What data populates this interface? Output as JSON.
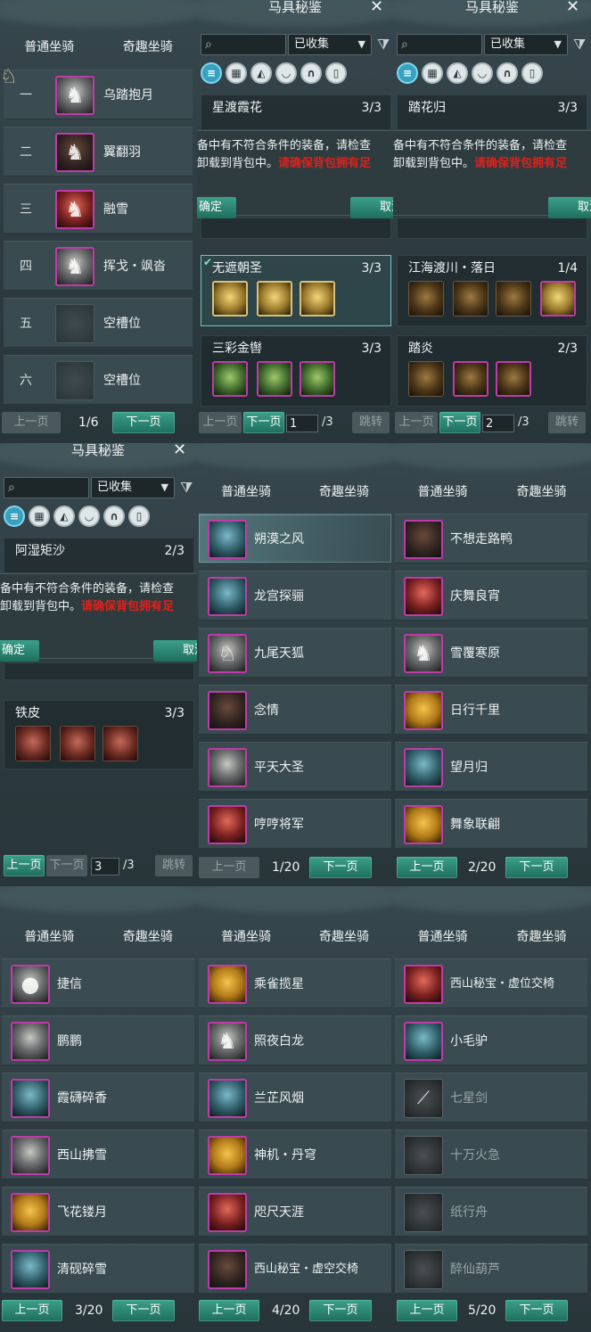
{
  "tabs": {
    "normal": "普通坐骑",
    "fun": "奇趣坐骑"
  },
  "pager": {
    "prev": "上一页",
    "next": "下一页",
    "jump": "跳转"
  },
  "dialog": {
    "line1": "备中有不符合条件的装备，请检查",
    "line2a": "卸载到背包中。",
    "line2b": "请确保背包拥有足",
    "ok": "确定",
    "cancel": "取消"
  },
  "codex": {
    "title": "马具秘鉴",
    "filter_value": "已收集"
  },
  "p1": {
    "page": "1/6",
    "rows": [
      {
        "num": "一",
        "name": "乌踏抱月"
      },
      {
        "num": "二",
        "name": "翼翻羽"
      },
      {
        "num": "三",
        "name": "融雪"
      },
      {
        "num": "四",
        "name": "挥戈・飒沓"
      },
      {
        "num": "五",
        "name": "空槽位"
      },
      {
        "num": "六",
        "name": "空槽位"
      }
    ]
  },
  "p2": {
    "page_input": "1",
    "total": "/3",
    "sets": [
      {
        "name": "星渡霞花",
        "count": "3/3"
      },
      {
        "name": "无遮朝圣",
        "count": "3/3"
      },
      {
        "name": "三彩金辔",
        "count": "3/3"
      }
    ]
  },
  "p3": {
    "page_input": "2",
    "total": "/3",
    "sets": [
      {
        "name": "踏花归",
        "count": "3/3"
      },
      {
        "name": "江海渡川・落日",
        "count": "1/4"
      },
      {
        "name": "踏炎",
        "count": "2/3"
      }
    ]
  },
  "p4": {
    "page_input": "3",
    "total": "/3",
    "sets": [
      {
        "name": "阿湿矩沙",
        "count": "2/3"
      },
      {
        "name": "铁皮",
        "count": "3/3"
      }
    ]
  },
  "p5": {
    "page": "1/20",
    "rows": [
      "朔漠之风",
      "龙宫探骊",
      "九尾天狐",
      "念情",
      "平天大圣",
      "哼哼将军"
    ]
  },
  "p6": {
    "page": "2/20",
    "rows": [
      "不想走路鸭",
      "庆舞良宵",
      "雪覆寒原",
      "日行千里",
      "望月归",
      "舞象联翩"
    ]
  },
  "p7": {
    "page": "3/20",
    "rows": [
      "捷信",
      "鹏鹏",
      "霞礴碎香",
      "西山拂雪",
      "飞花镂月",
      "清砚碎雪"
    ]
  },
  "p8": {
    "page": "4/20",
    "rows": [
      "乘雀揽星",
      "照夜白龙",
      "兰芷风烟",
      "神机・丹穹",
      "咫尺天涯",
      "西山秘宝・虚空交椅"
    ]
  },
  "p9": {
    "page": "5/20",
    "rows": [
      "西山秘宝・虚位交椅",
      "小毛驴",
      "七星剑",
      "十万火急",
      "纸行舟",
      "醉仙葫芦"
    ]
  },
  "colors": {
    "accent": "#2a8a76",
    "selected_border": "#c03ba8",
    "warning": "#e0201a"
  }
}
